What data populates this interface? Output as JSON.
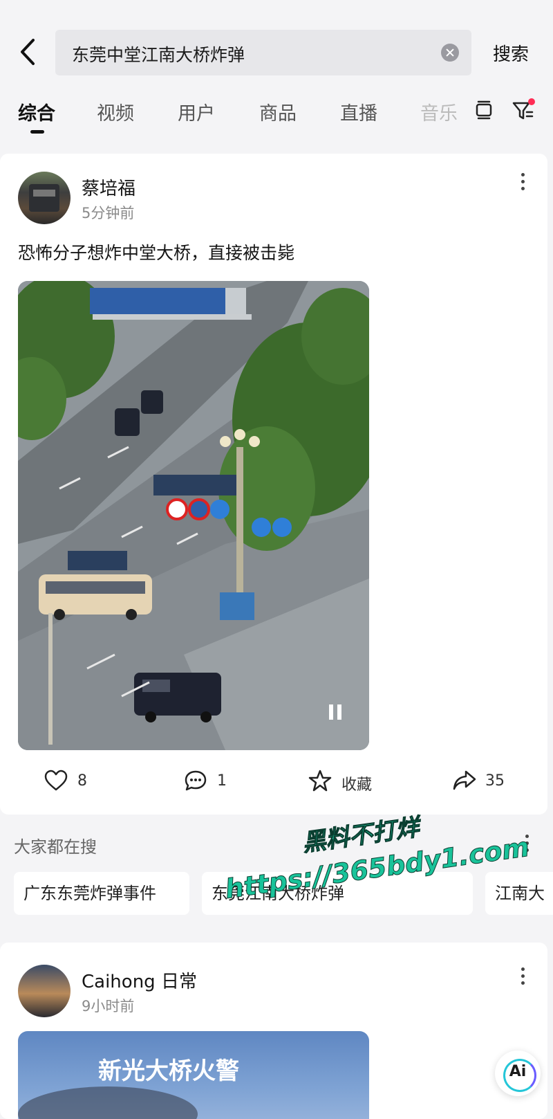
{
  "search": {
    "query": "东莞中堂江南大桥炸弹",
    "search_button": "搜索"
  },
  "tabs": [
    {
      "label": "综合",
      "active": true
    },
    {
      "label": "视频"
    },
    {
      "label": "用户"
    },
    {
      "label": "商品"
    },
    {
      "label": "直播"
    },
    {
      "label": "音乐"
    }
  ],
  "post": {
    "username": "蔡培福",
    "timestamp": "5分钟前",
    "text": "恐怖分子想炸中堂大桥，直接被击毙",
    "likes": "8",
    "comments": "1",
    "favorite_label": "收藏",
    "shares": "35"
  },
  "trending": {
    "title": "大家都在搜",
    "chips": [
      "广东东莞炸弹事件",
      "东莞江南大桥炸弹",
      "江南大"
    ]
  },
  "watermark": {
    "line1": "黑料不打烊",
    "line2": "https://365bdy1.com"
  },
  "post2": {
    "username": "Caihong 日常",
    "timestamp": "9小时前",
    "thumbnail_text": "新光大桥火警"
  },
  "ai_button": "Ai",
  "colors": {
    "accent_red": "#ff2d55",
    "watermark_green": "#19c39a"
  }
}
